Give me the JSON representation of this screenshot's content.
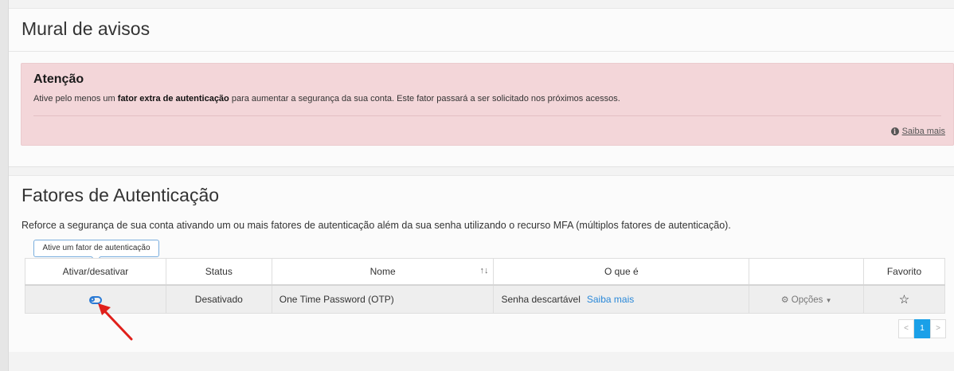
{
  "notices": {
    "title": "Mural de avisos",
    "alert": {
      "title": "Atenção",
      "message_pre": "Ative pelo menos um ",
      "message_bold": "fator extra de autenticação",
      "message_post": " para aumentar a segurança da sua conta. Este fator passará a ser solicitado nos próximos acessos.",
      "link": "Saiba mais"
    }
  },
  "factors": {
    "title": "Fatores de Autenticação",
    "description": "Reforce a segurança de sua conta ativando um ou mais fatores de autenticação além da sua senha utilizando o recurso MFA (múltiplos fatores de autenticação).",
    "tooltip": "Ative um fator de autenticação",
    "columns": [
      "Ativar/desativar",
      "Status",
      "Nome",
      "O que é",
      "",
      "Favorito"
    ],
    "rows": [
      {
        "status": "Desativado",
        "name": "One Time Password (OTP)",
        "what": "Senha descartável",
        "what_link": "Saiba mais",
        "options": "Opções",
        "toggle_on": false
      }
    ],
    "pagination": {
      "prev": "<",
      "current": "1",
      "next": ">"
    }
  },
  "colors": {
    "accent": "#2a7ad5",
    "alert_bg": "#f3d6d9",
    "page_active": "#1aa0e8",
    "arrow": "#e0201b"
  }
}
